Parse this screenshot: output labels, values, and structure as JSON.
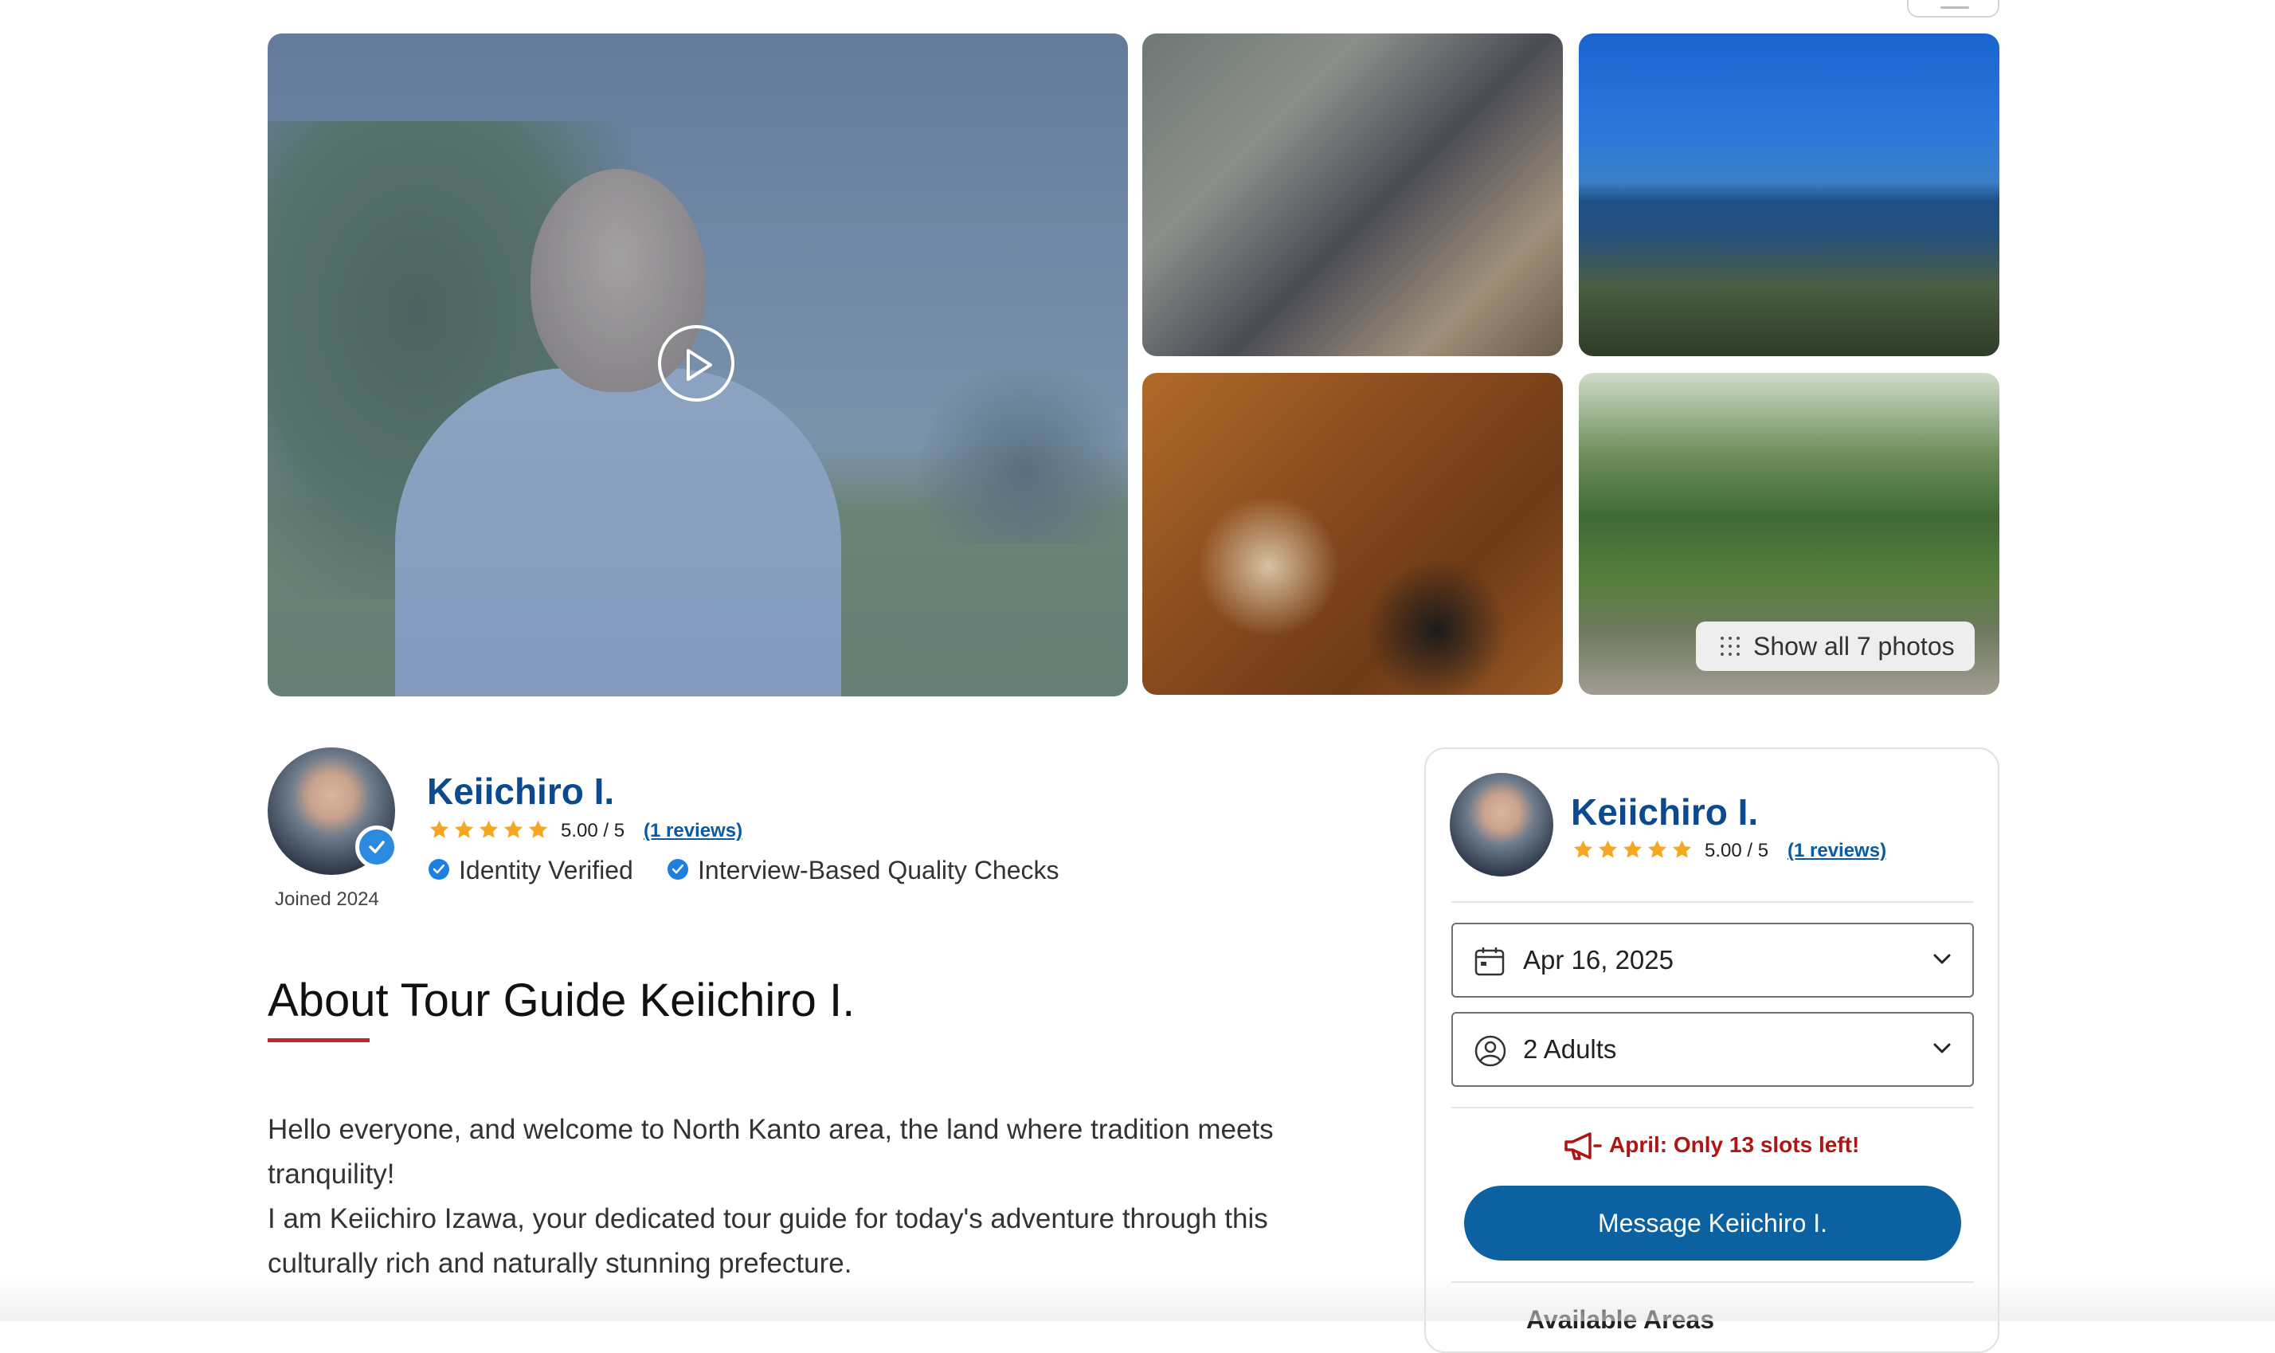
{
  "gallery": {
    "show_all_label": "Show all 7 photos",
    "photos": [
      "cafe-selfie",
      "coastal-path",
      "japanese-meal",
      "forest-garden"
    ]
  },
  "guide": {
    "name": "Keiichiro I.",
    "rating_text": "5.00 / 5",
    "stars": 5,
    "reviews_link": "(1 reviews)",
    "joined": "Joined 2024",
    "badges": [
      "Identity Verified",
      "Interview-Based Quality Checks"
    ]
  },
  "about": {
    "title": "About Tour Guide Keiichiro I.",
    "paragraph_lines": [
      "Hello everyone, and welcome to North Kanto area, the land where tradition meets",
      "tranquility!",
      "I am Keiichiro Izawa, your dedicated tour guide for today's adventure through this",
      "culturally rich and naturally stunning prefecture."
    ]
  },
  "booking": {
    "name": "Keiichiro I.",
    "rating_text": "5.00 / 5",
    "reviews_link": "(1 reviews)",
    "date_value": "Apr 16, 2025",
    "guests_value": "2 Adults",
    "slots_notice": "April: Only 13 slots left!",
    "message_button": "Message Keiichiro I.",
    "available_areas_label": "Available Areas"
  },
  "colors": {
    "brand_blue": "#0b4a8e",
    "button_blue": "#0c61a0",
    "star": "#f5a623",
    "alert_red": "#b01414",
    "accent_red": "#c1272d"
  }
}
